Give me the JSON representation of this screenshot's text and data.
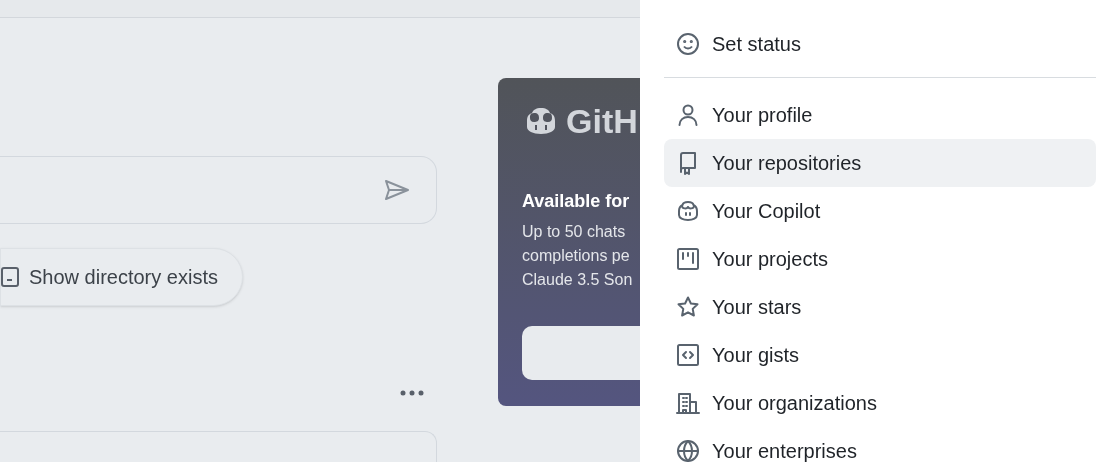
{
  "chat": {
    "suggestion": "Show directory exists"
  },
  "promo": {
    "brand": "GitH",
    "heading": "Available for",
    "lines": [
      "Up to 50 chats",
      "completions pe",
      "Claude 3.5 Son"
    ]
  },
  "menu": {
    "status": "Set status",
    "items": [
      {
        "kind": "person",
        "label": "Your profile",
        "selected": false
      },
      {
        "kind": "repo",
        "label": "Your repositories",
        "selected": true
      },
      {
        "kind": "copilot",
        "label": "Your Copilot",
        "selected": false
      },
      {
        "kind": "projects",
        "label": "Your projects",
        "selected": false
      },
      {
        "kind": "star",
        "label": "Your stars",
        "selected": false
      },
      {
        "kind": "gist",
        "label": "Your gists",
        "selected": false
      },
      {
        "kind": "org",
        "label": "Your organizations",
        "selected": false
      },
      {
        "kind": "globe",
        "label": "Your enterprises",
        "selected": false
      }
    ]
  }
}
